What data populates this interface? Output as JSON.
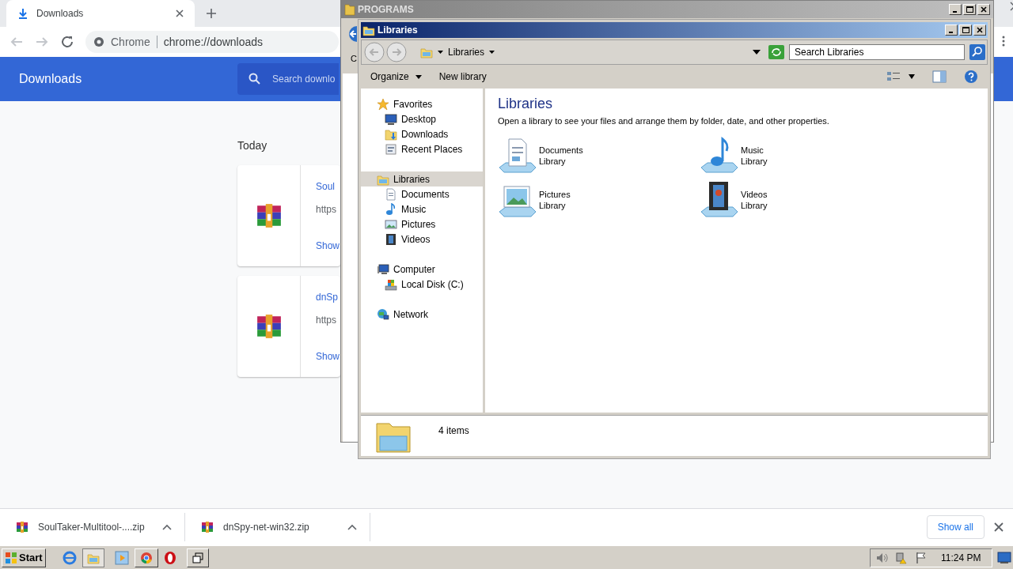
{
  "browser": {
    "tab": {
      "title": "Downloads"
    },
    "address": {
      "site_label": "Chrome",
      "url": "chrome://downloads"
    },
    "page_title": "Downloads",
    "search": {
      "placeholder": "Search downlo"
    },
    "section": "Today",
    "downloads": [
      {
        "name": "Soul",
        "url": "https",
        "action": "Show"
      },
      {
        "name": "dnSp",
        "url": "https",
        "action": "Show"
      }
    ],
    "shelf": {
      "items": [
        {
          "name": "SoulTaker-Multitool-....zip"
        },
        {
          "name": "dnSpy-net-win32.zip"
        }
      ],
      "show_all": "Show all"
    }
  },
  "programs_window": {
    "title": "PROGRAMS",
    "toolbar_text": "C"
  },
  "explorer": {
    "title": "Libraries",
    "breadcrumb": "Libraries",
    "search": {
      "placeholder": "Search Libraries"
    },
    "toolbar": [
      {
        "label": "Organize",
        "kind": "menu"
      },
      {
        "label": "New library",
        "kind": "button"
      }
    ],
    "nav": [
      {
        "label": "Favorites",
        "kind": "star",
        "selected": false,
        "children": [
          {
            "label": "Desktop",
            "kind": "desktop",
            "selected": false
          },
          {
            "label": "Downloads",
            "kind": "downloads",
            "selected": false
          },
          {
            "label": "Recent Places",
            "kind": "recent",
            "selected": false
          }
        ]
      },
      {
        "label": "Libraries",
        "kind": "library",
        "selected": true,
        "children": [
          {
            "label": "Documents",
            "kind": "documents",
            "selected": false
          },
          {
            "label": "Music",
            "kind": "music",
            "selected": false
          },
          {
            "label": "Pictures",
            "kind": "pictures",
            "selected": false
          },
          {
            "label": "Videos",
            "kind": "videos",
            "selected": false
          }
        ]
      },
      {
        "label": "Computer",
        "kind": "computer",
        "selected": false,
        "children": [
          {
            "label": "Local Disk (C:)",
            "kind": "disk",
            "selected": false
          }
        ]
      },
      {
        "label": "Network",
        "kind": "network",
        "selected": false
      }
    ],
    "heading": "Libraries",
    "description": "Open a library to see your files and arrange them by folder, date, and other properties.",
    "libraries": [
      {
        "name": "Documents",
        "subtitle": "Library",
        "kind": "documents"
      },
      {
        "name": "Music",
        "subtitle": "Library",
        "kind": "music"
      },
      {
        "name": "Pictures",
        "subtitle": "Library",
        "kind": "pictures"
      },
      {
        "name": "Videos",
        "subtitle": "Library",
        "kind": "videos"
      }
    ],
    "status": "4 items"
  },
  "taskbar": {
    "start": "Start",
    "clock": "11:24 PM"
  }
}
